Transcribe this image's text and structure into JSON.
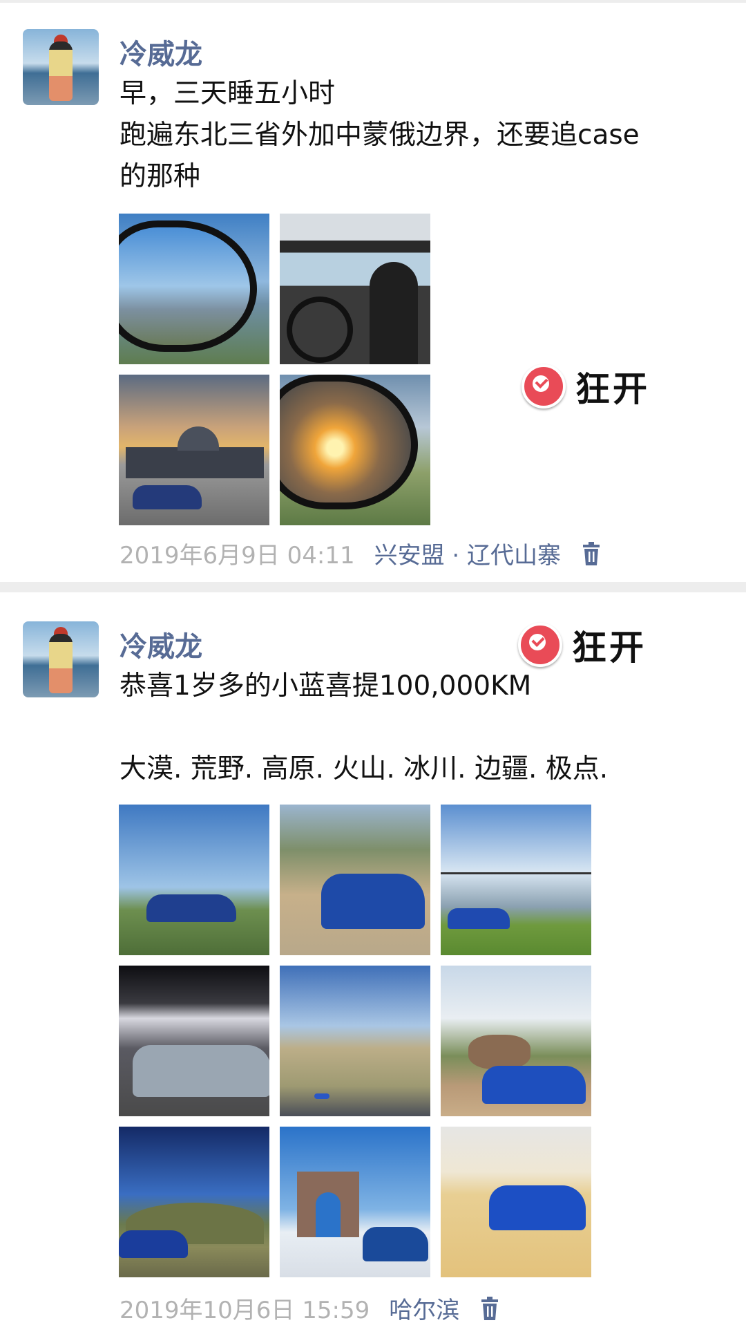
{
  "post1": {
    "username": "冷威龙",
    "text": "早，三天睡五小时\n跑遍东北三省外加中蒙俄边界，还要追case\n的那种",
    "timestamp": "2019年6月9日 04:11",
    "location": "兴安盟 · 辽代山寨",
    "sticker": "狂开"
  },
  "post2": {
    "username": "冷威龙",
    "text": "恭喜1岁多的小蓝喜提100,000KM\n\n大漠. 荒野. 高原. 火山. 冰川. 边疆. 极点.",
    "timestamp": "2019年10月6日 15:59",
    "location": "哈尔滨",
    "sticker": "狂开"
  },
  "icons": [
    "trash-icon",
    "check-pin-icon"
  ],
  "colors": {
    "name": "#576b95",
    "meta": "#b2b2b2",
    "sticker_pin": "#e94b57"
  }
}
